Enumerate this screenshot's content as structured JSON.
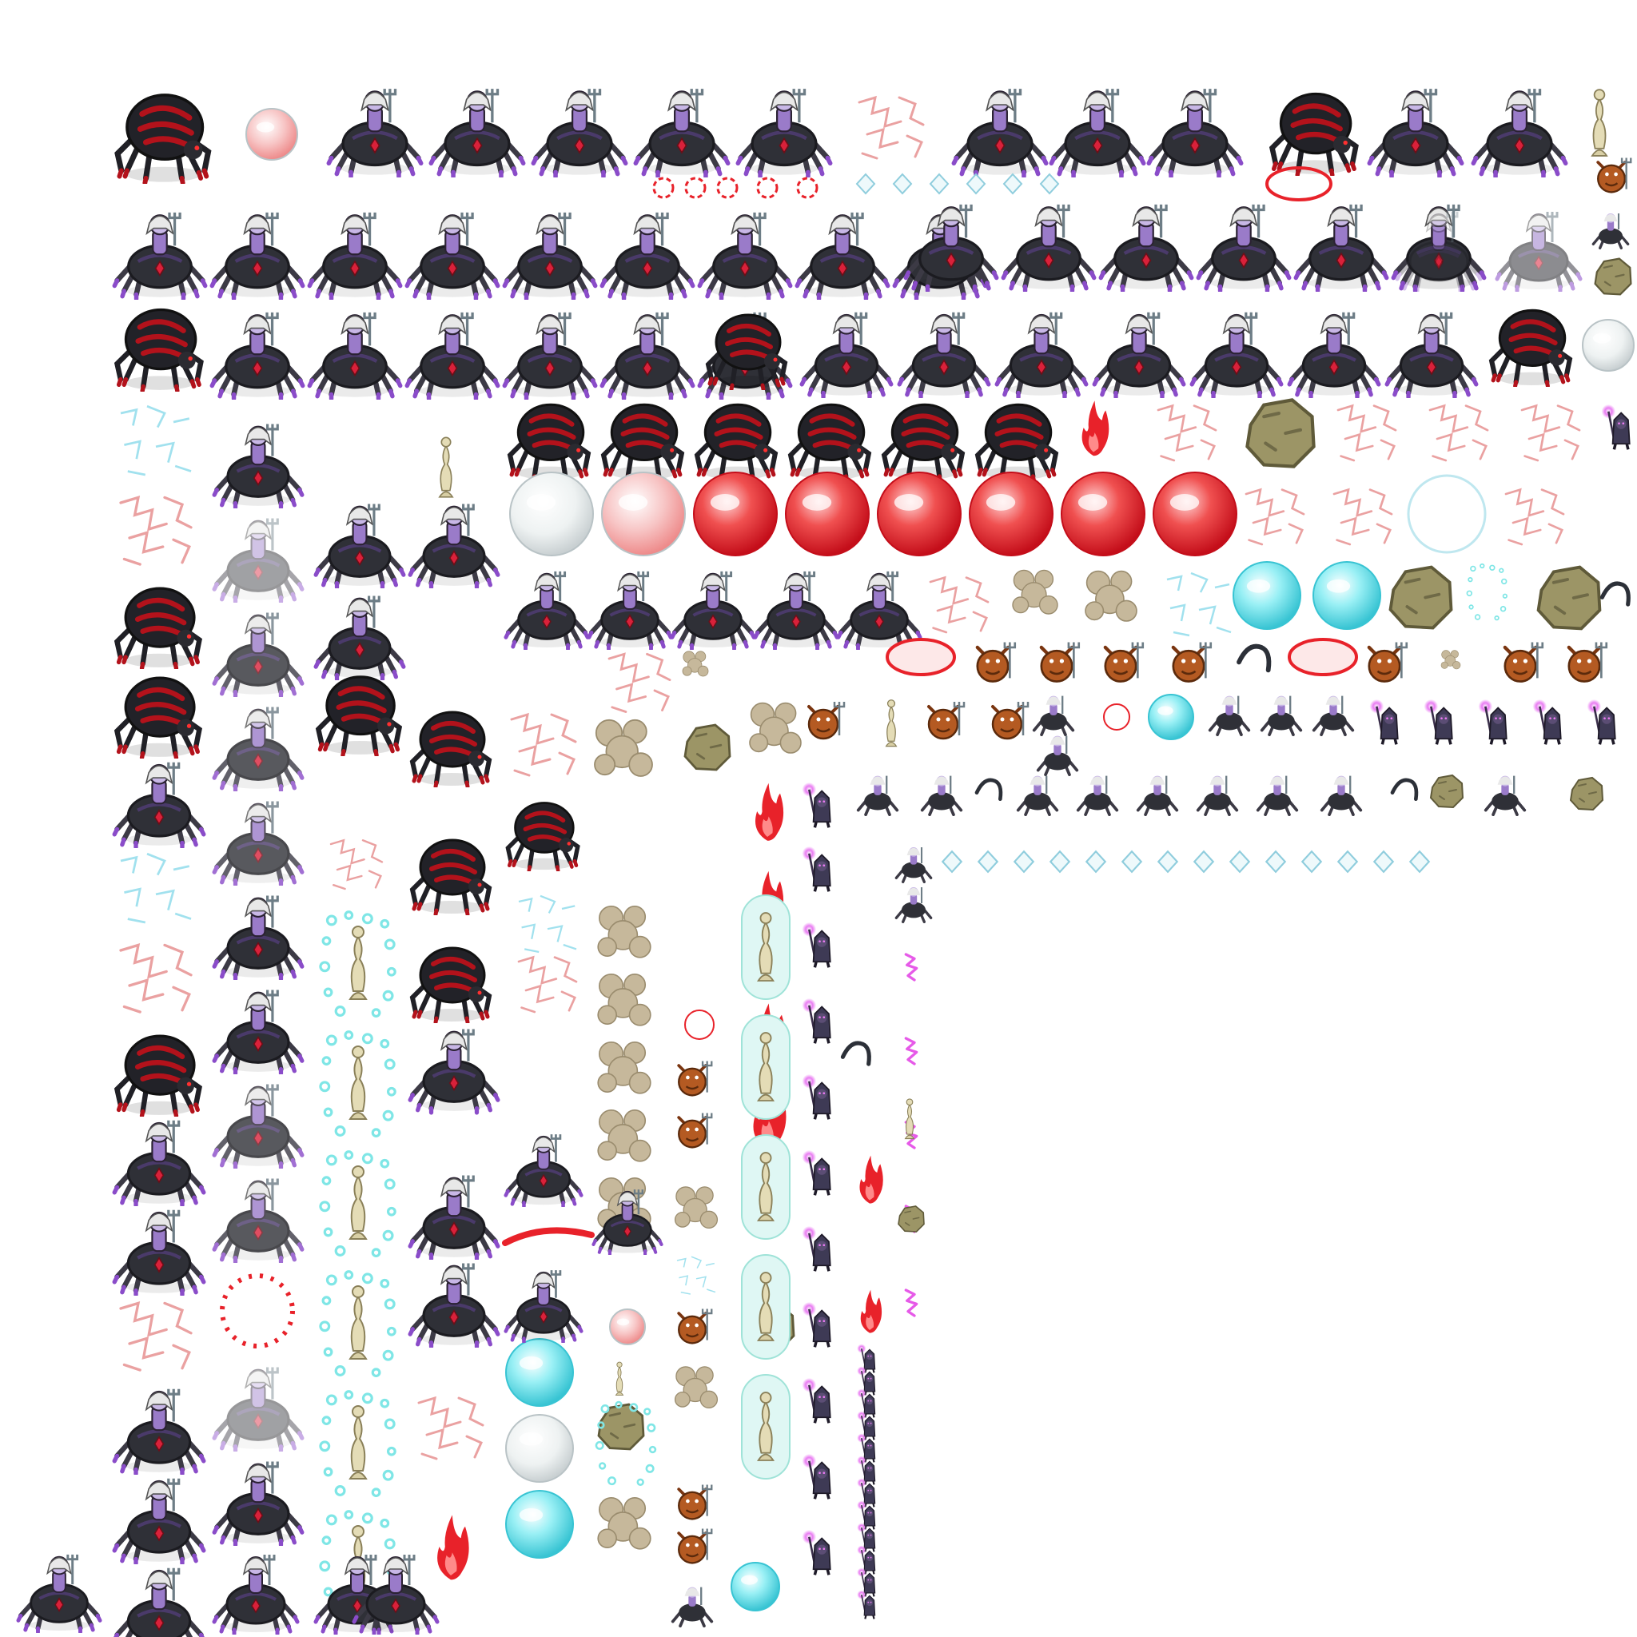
{
  "sheet": {
    "title": "",
    "background": "#ffffff",
    "sprite_kinds": [
      "spider-mount-rider",
      "red-spider",
      "faded-spider-rider",
      "red-tinted-rider",
      "red-bubble",
      "cyan-bubble",
      "white-bubble",
      "red-web",
      "cyan-web",
      "pink-lightning",
      "cyan-particles",
      "boulder",
      "cocoon-totem",
      "dust-cloud",
      "red-flame",
      "orange-demon",
      "purple-mage",
      "small-rider",
      "tentacle",
      "diamond-shard"
    ],
    "colors": {
      "spider_body": "#2f3037",
      "spider_red_stripe": "#b3121b",
      "spider_leg": "#4a3a6a",
      "leg_tip": "#8a4cc9",
      "rider_skin": "#c8b7e6",
      "rider_hair": "#e8e8e8",
      "gem": "#d9213a",
      "red_bubble": "#e8222a",
      "cyan_bubble": "#5ee0ea",
      "white_bubble": "#f1f4f4",
      "web_red": "#e58a8a",
      "web_cyan": "#8ad9ea",
      "boulder": "#9c9566",
      "totem": "#d8cfa5",
      "dust": "#b7a88c",
      "flame": "#e8222a",
      "demon": "#b45a22",
      "mage_glow": "#d957e6",
      "shard": "#bfe7ef"
    }
  }
}
